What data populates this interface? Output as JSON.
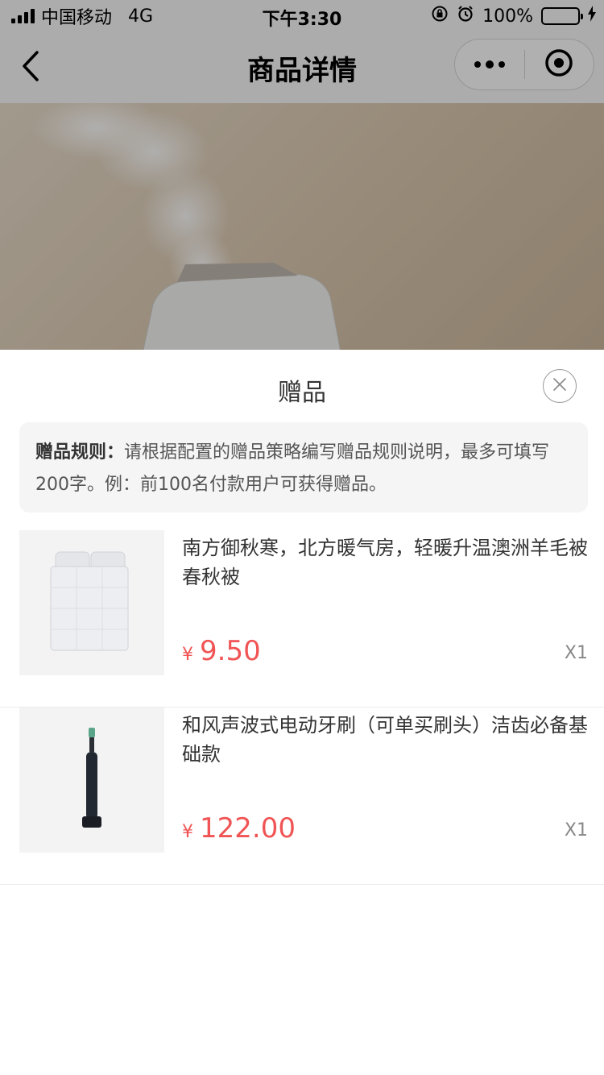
{
  "status_bar": {
    "carrier": "中国移动",
    "network": "4G",
    "time": "下午3:30",
    "battery_text": "100%"
  },
  "nav": {
    "title": "商品详情",
    "back_icon": "chevron-left-icon",
    "more_icon": "more-dots-icon",
    "target_icon": "target-icon"
  },
  "sheet": {
    "title": "赠品",
    "close_icon": "close-icon",
    "rules_label": "赠品规则：",
    "rules_text": "请根据配置的赠品策略编写赠品规则说明，最多可填写200字。例：前100名付款用户可获得赠品。"
  },
  "gifts": [
    {
      "name": "南方御秋寒，北方暖气房，轻暖升温澳洲羊毛被 春秋被",
      "currency": "¥",
      "price": "9.50",
      "qty": "X1",
      "image_icon": "quilt-bed-icon"
    },
    {
      "name": "和风声波式电动牙刷（可单买刷头）洁齿必备基础款",
      "currency": "¥",
      "price": "122.00",
      "qty": "X1",
      "image_icon": "electric-toothbrush-icon"
    }
  ],
  "colors": {
    "price": "#f05454",
    "battery": "#4cd964",
    "mask": "rgba(0,0,0,0.3)"
  }
}
